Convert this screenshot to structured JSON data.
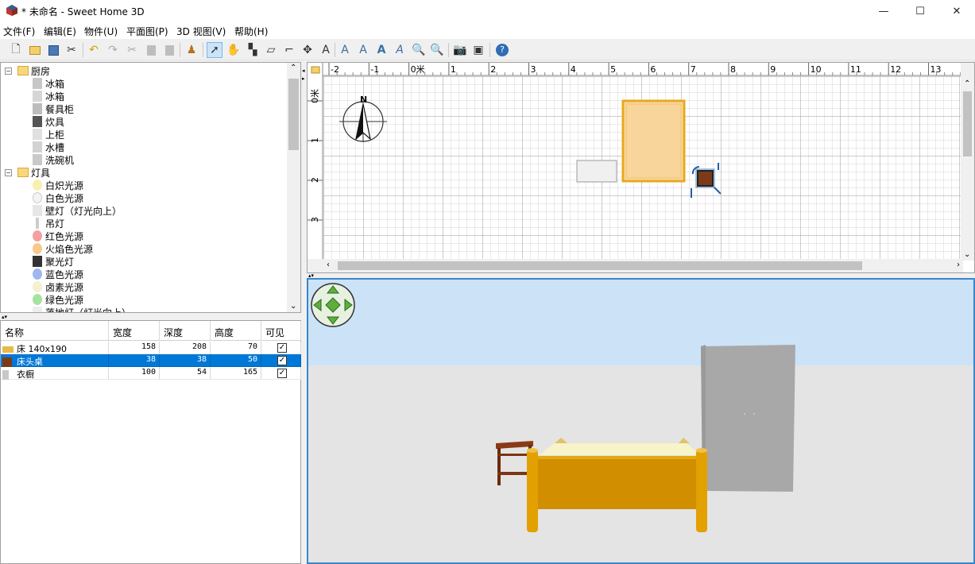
{
  "window": {
    "title": "* 未命名 - Sweet Home 3D",
    "minimize": "—",
    "maximize": "☐",
    "close": "✕"
  },
  "menu": [
    "文件(F)",
    "编辑(E)",
    "物件(U)",
    "平面图(P)",
    "3D 视图(V)",
    "帮助(H)"
  ],
  "catalog": {
    "categories": [
      {
        "name": "厨房",
        "items": [
          "冰箱",
          "冰箱",
          "餐具柜",
          "炊具",
          "上柜",
          "水槽",
          "洗碗机"
        ]
      },
      {
        "name": "灯具",
        "items": [
          "白炽光源",
          "白色光源",
          "壁灯（灯光向上）",
          "吊灯",
          "红色光源",
          "火焰色光源",
          "聚光灯",
          "蓝色光源",
          "卤素光源",
          "绿色光源",
          "落地灯（灯光向上）"
        ]
      }
    ]
  },
  "furniture_table": {
    "columns": [
      "名称",
      "宽度",
      "深度",
      "高度",
      "可见"
    ],
    "rows": [
      {
        "name": "床 140x190",
        "width": "158",
        "depth": "208",
        "height": "70",
        "visible": true,
        "selected": false
      },
      {
        "name": "床头桌",
        "width": "38",
        "depth": "38",
        "height": "50",
        "visible": true,
        "selected": true
      },
      {
        "name": "衣橱",
        "width": "100",
        "depth": "54",
        "height": "165",
        "visible": true,
        "selected": false
      }
    ]
  },
  "plan": {
    "ruler_x": [
      "-2",
      "-1",
      "0米",
      "1",
      "2",
      "3",
      "4",
      "5",
      "6",
      "7",
      "8",
      "9",
      "10",
      "11",
      "12",
      "13"
    ],
    "ruler_y": [
      "0米",
      "1",
      "2",
      "3"
    ],
    "compass_label": "N"
  },
  "colors": {
    "accent": "#0078d7",
    "bed": "#d49a00",
    "bed_light": "#f7d79c",
    "wardrobe": "#a8a8a8",
    "sky": "#cce3f7",
    "ground": "#e4e4e4"
  }
}
